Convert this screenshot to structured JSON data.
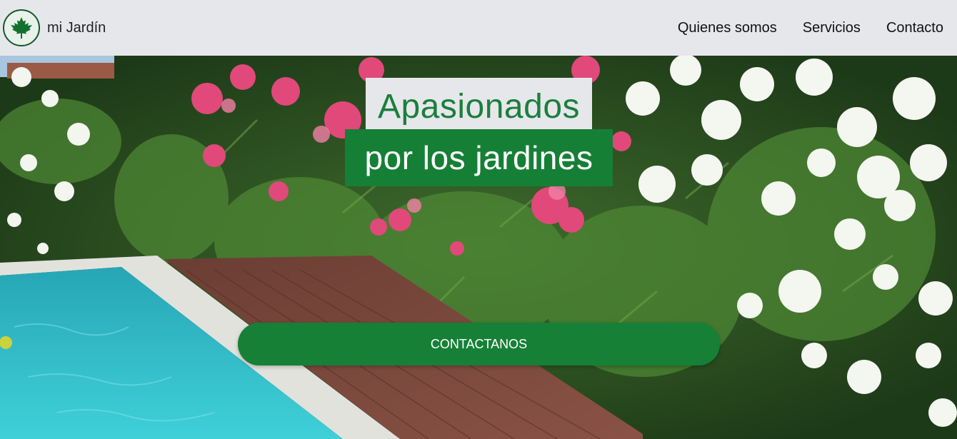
{
  "brand": {
    "name": "mi Jardín",
    "logo_icon": "maple-leaf-icon"
  },
  "nav": {
    "items": [
      {
        "label": "Quienes somos"
      },
      {
        "label": "Servicios"
      },
      {
        "label": "Contacto"
      }
    ]
  },
  "hero": {
    "headline_line1": "Apasionados",
    "headline_line2": "por los jardines",
    "cta_label": "CONTACTANOS",
    "background_image": "garden-pool-photo"
  },
  "colors": {
    "brand_green": "#167f36",
    "nav_background": "#e6e7eb",
    "headline_green_text": "#1b7f3b"
  }
}
